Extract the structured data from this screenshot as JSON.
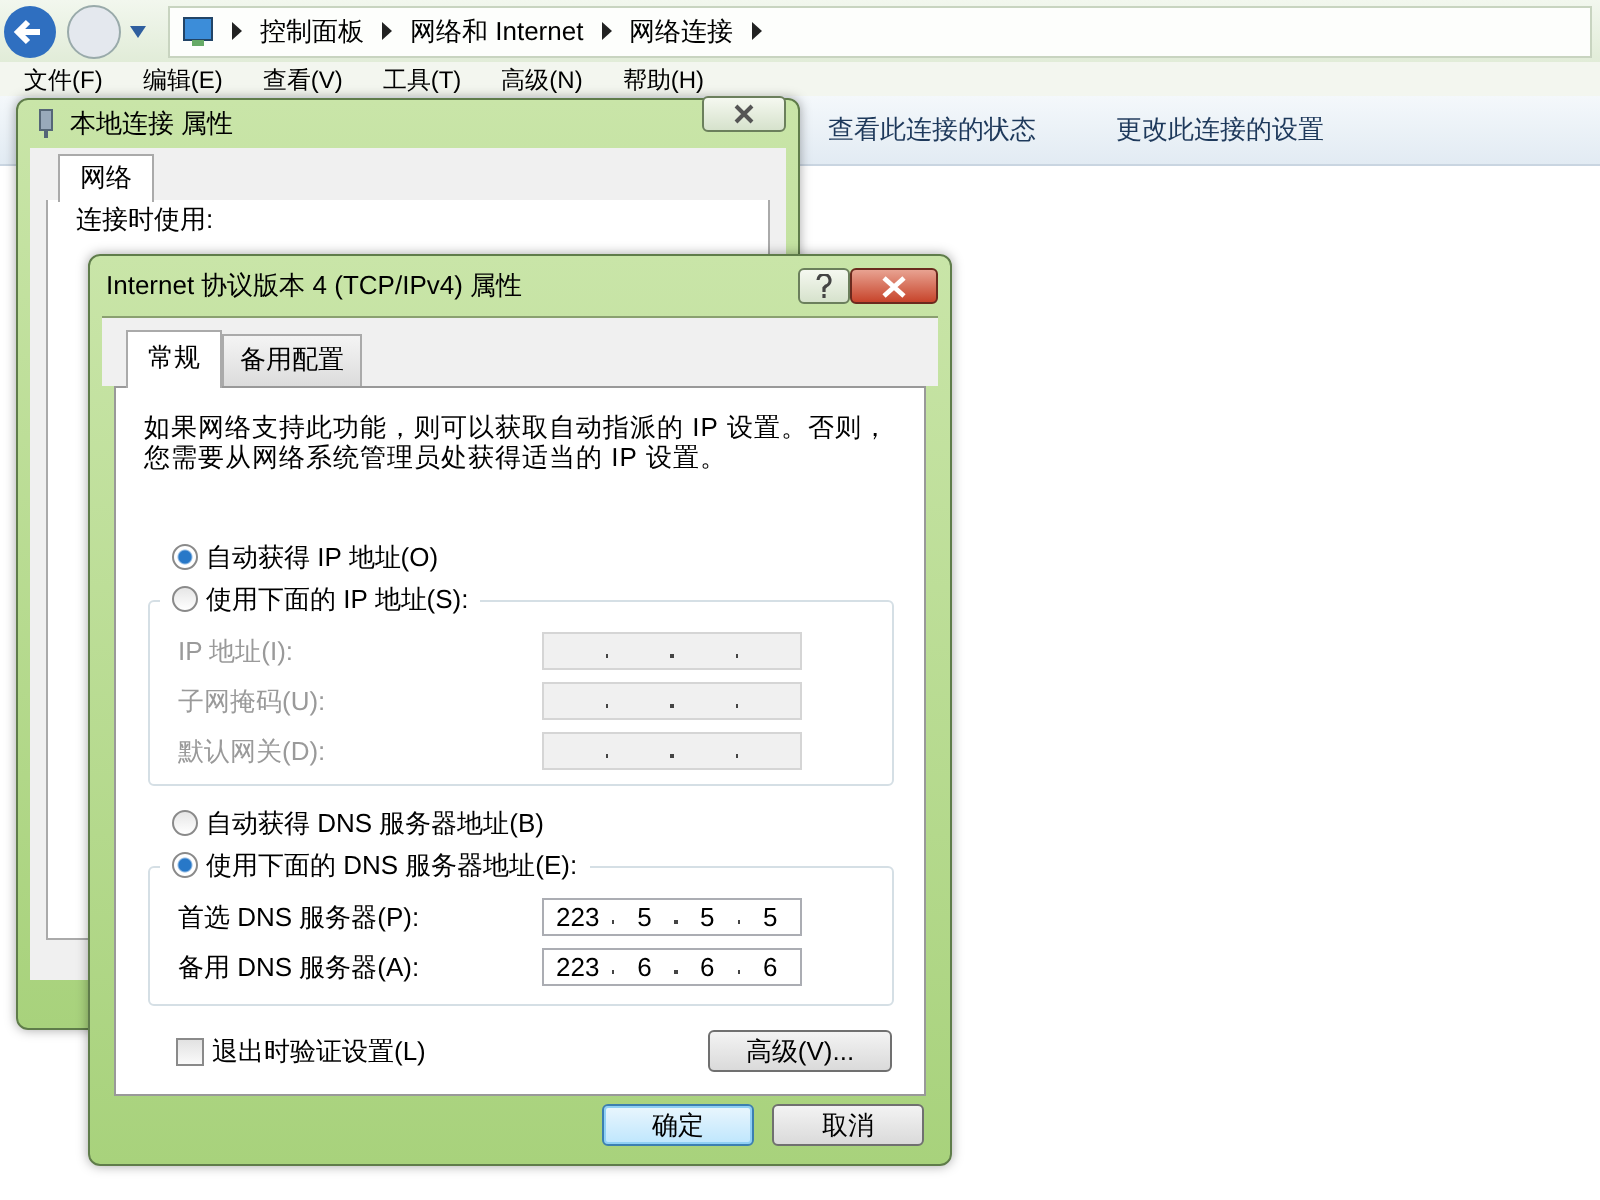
{
  "explorer": {
    "breadcrumb": [
      "控制面板",
      "网络和 Internet",
      "网络连接"
    ],
    "menu": [
      "文件(F)",
      "编辑(E)",
      "查看(V)",
      "工具(T)",
      "高级(N)",
      "帮助(H)"
    ],
    "toolbar": [
      "查看此连接的状态",
      "更改此连接的设置"
    ]
  },
  "back_dialog": {
    "title": "本地连接 属性",
    "tabs": [
      {
        "label": "网络",
        "selected": true
      }
    ],
    "label": "连接时使用:"
  },
  "dialog": {
    "title": "Internet 协议版本 4 (TCP/IPv4) 属性",
    "tabs": [
      {
        "label": "常规",
        "selected": true
      },
      {
        "label": "备用配置",
        "selected": false
      }
    ],
    "description": "如果网络支持此功能，则可以获取自动指派的 IP 设置。否则，您需要从网络系统管理员处获得适当的 IP 设置。",
    "ip_options": [
      {
        "label": "自动获得 IP 地址(O)",
        "selected": true
      },
      {
        "label": "使用下面的 IP 地址(S):",
        "selected": false
      }
    ],
    "ip_fields": [
      {
        "label": "IP 地址(I):",
        "disabled": true
      },
      {
        "label": "子网掩码(U):",
        "disabled": true
      },
      {
        "label": "默认网关(D):",
        "disabled": true
      }
    ],
    "dns_options": [
      {
        "label": "自动获得 DNS 服务器地址(B)",
        "selected": false
      },
      {
        "label": "使用下面的 DNS 服务器地址(E):",
        "selected": true
      }
    ],
    "dns_fields": [
      {
        "label": "首选 DNS 服务器(P):",
        "disabled": false,
        "octets": [
          "223",
          "5",
          "5",
          "5"
        ]
      },
      {
        "label": "备用 DNS 服务器(A):",
        "disabled": false,
        "octets": [
          "223",
          "6",
          "6",
          "6"
        ]
      }
    ],
    "validate": {
      "label": "退出时验证设置(L)",
      "checked": false
    },
    "advanced_button": "高级(V)...",
    "buttons": [
      {
        "label": "确定",
        "default": true
      },
      {
        "label": "取消",
        "default": false
      }
    ]
  }
}
